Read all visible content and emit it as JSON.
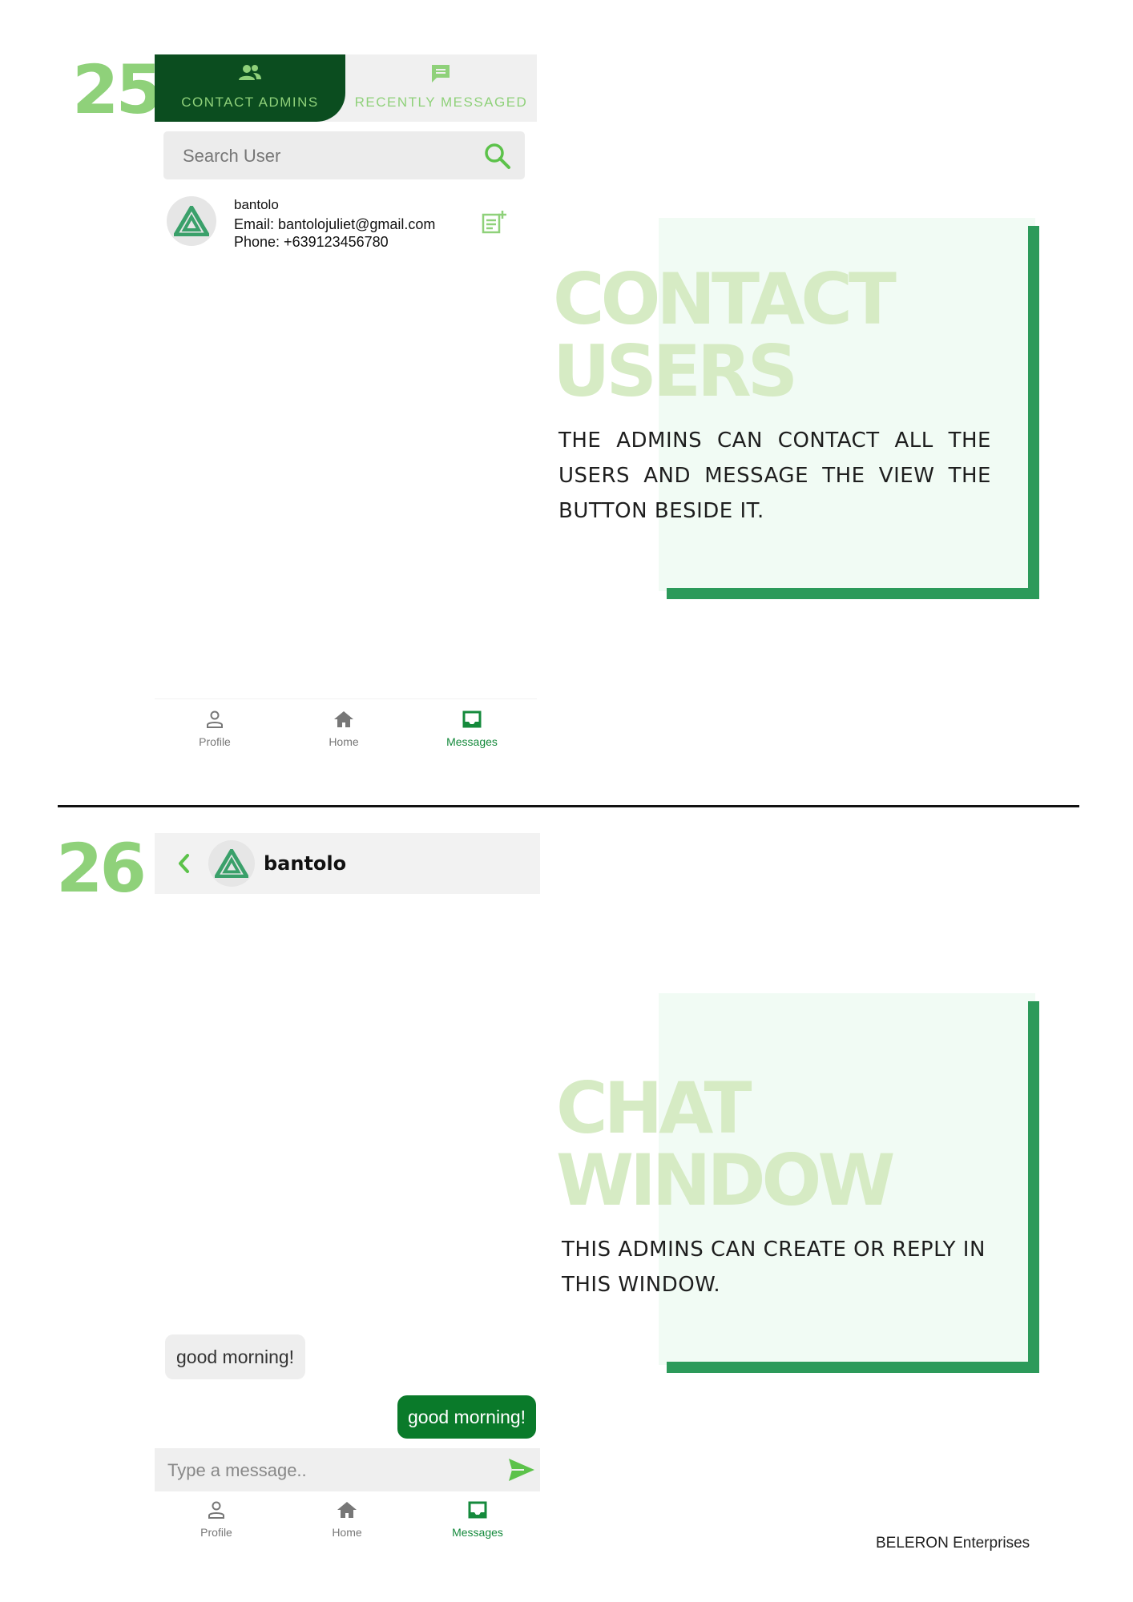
{
  "step25": {
    "number": "25",
    "tabs": [
      {
        "label": "CONTACT ADMINS",
        "icon": "users-icon"
      },
      {
        "label": "RECENTLY MESSAGED",
        "icon": "chat-icon"
      }
    ],
    "search": {
      "placeholder": "Search User"
    },
    "user": {
      "name": "bantolo",
      "email": "Email: bantolojuliet@gmail.com",
      "phone": "Phone: +639123456780"
    },
    "nav": [
      {
        "label": "Profile",
        "icon": "person-icon"
      },
      {
        "label": "Home",
        "icon": "home-icon"
      },
      {
        "label": "Messages",
        "icon": "inbox-icon"
      }
    ],
    "callout": {
      "title_line1": "CONTACT",
      "title_line2": "USERS",
      "body": "THE ADMINS CAN CONTACT ALL THE USERS AND MESSAGE THE VIEW THE BUTTON BESIDE IT."
    }
  },
  "step26": {
    "number": "26",
    "chat_name": "bantolo",
    "messages": [
      {
        "text": "good morning!",
        "direction": "incoming"
      },
      {
        "text": "good morning!",
        "direction": "outgoing"
      }
    ],
    "input_placeholder": "Type a message..",
    "nav": [
      {
        "label": "Profile",
        "icon": "person-icon"
      },
      {
        "label": "Home",
        "icon": "home-icon"
      },
      {
        "label": "Messages",
        "icon": "inbox-icon"
      }
    ],
    "callout": {
      "title_line1": "CHAT",
      "title_line2": "WINDOW",
      "body": "THIS ADMINS CAN CREATE OR REPLY IN THIS WINDOW."
    }
  },
  "footer": "BELERON Enterprises",
  "colors": {
    "brand_dark": "#0b4d1f",
    "brand_green": "#2c9a5a",
    "light_green": "#8fd17a",
    "callout_bg": "#f1fbf4",
    "title_faint": "#d6ebc4"
  }
}
